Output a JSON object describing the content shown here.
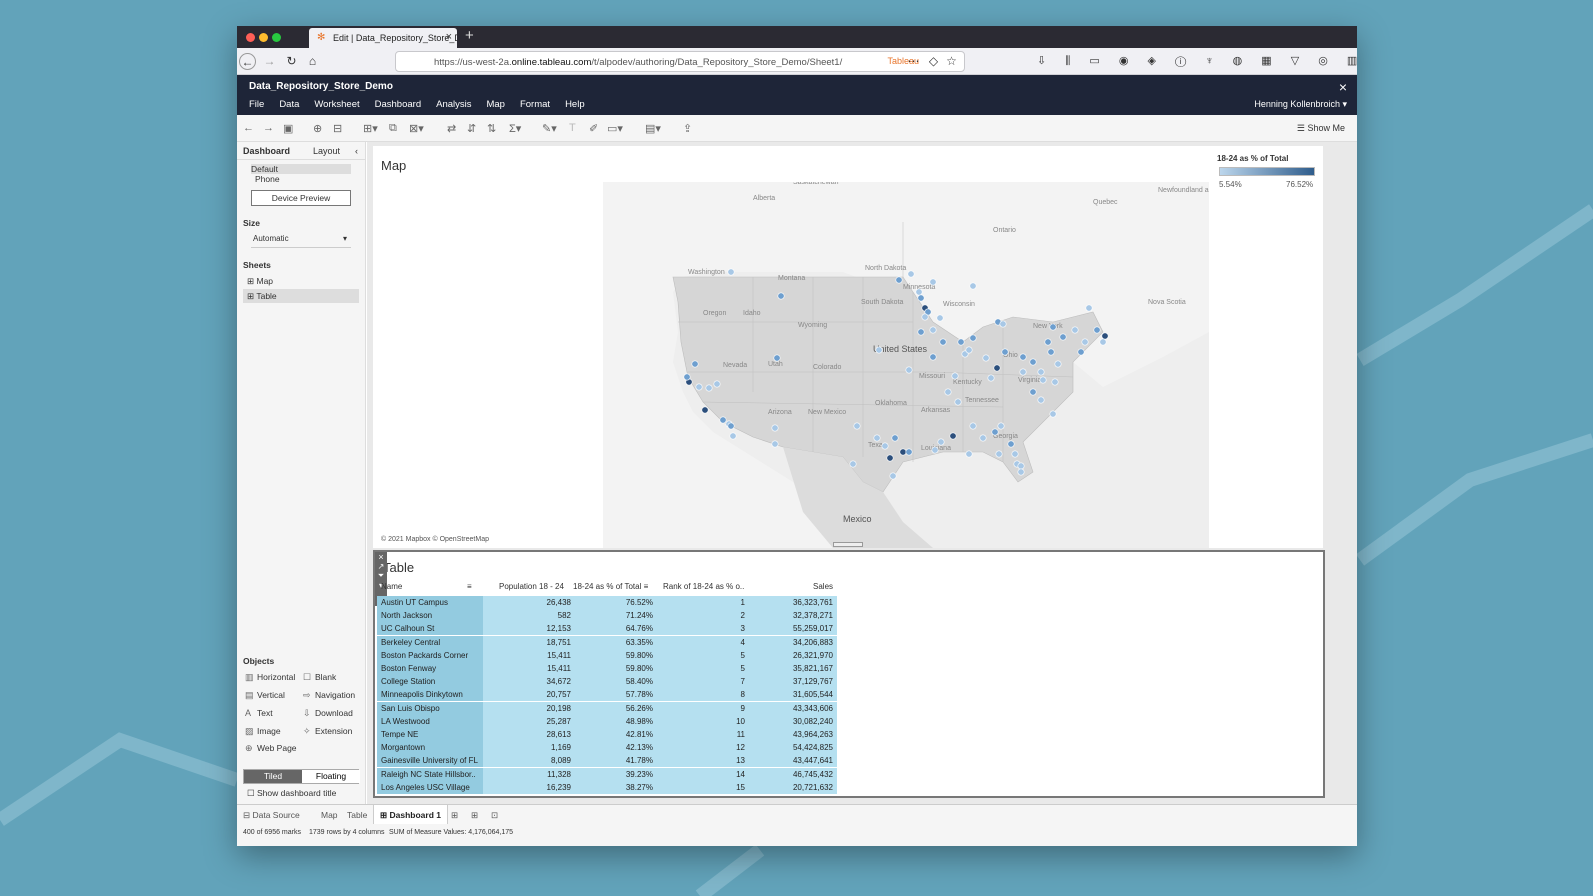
{
  "browser": {
    "tab_title": "Edit | Data_Repository_Store_De",
    "url_prefix": "https://us-west-2a.",
    "url_host": "online.tableau.com",
    "url_path": "/t/alpodev/authoring/Data_Repository_Store_Demo/Sheet1/",
    "url_badge": "Tableau"
  },
  "app": {
    "workbook_title": "Data_Repository_Store_Demo",
    "menu": [
      "File",
      "Data",
      "Worksheet",
      "Dashboard",
      "Analysis",
      "Map",
      "Format",
      "Help"
    ],
    "user": "Henning Kollenbroich",
    "show_me": "Show Me"
  },
  "left_panel": {
    "tabs": [
      "Dashboard",
      "Layout"
    ],
    "device_default": "Default",
    "device_phone": "Phone",
    "device_preview": "Device Preview",
    "size_label": "Size",
    "size_value": "Automatic",
    "sheets_label": "Sheets",
    "sheets": [
      "Map",
      "Table"
    ],
    "objects_label": "Objects",
    "objects": [
      "Horizontal",
      "Blank",
      "Vertical",
      "Navigation",
      "Text",
      "Download",
      "Image",
      "Extension",
      "Web Page"
    ],
    "tiled": "Tiled",
    "floating": "Floating",
    "show_title": "Show dashboard title"
  },
  "map": {
    "title": "Map",
    "legend_title": "18-24 as % of Total",
    "legend_min": "5.54%",
    "legend_max": "76.52%",
    "attribution": "© 2021 Mapbox  © OpenStreetMap",
    "labels": [
      "Alberta",
      "Saskatchewan",
      "Ontario",
      "Quebec",
      "Newfoundland and Labrador",
      "Washington",
      "Montana",
      "North Dakota",
      "Minnesota",
      "Wisconsin",
      "Oregon",
      "Idaho",
      "Wyoming",
      "South Dakota",
      "Nevada",
      "Utah",
      "Colorado",
      "United States",
      "Missouri",
      "Kentucky",
      "Ohio",
      "Virginia",
      "New York",
      "Nova Scotia",
      "Arizona",
      "New Mexico",
      "Oklahoma",
      "Arkansas",
      "Tennessee",
      "Texas",
      "Louisiana",
      "Georgia",
      "Mexico"
    ],
    "colors": {
      "light": "#a8c8e6",
      "mid": "#6e9fcf",
      "dark": "#2c4f7c"
    }
  },
  "table": {
    "title": "Table",
    "columns": [
      "Name",
      "Population 18 - 24",
      "18-24 as % of Total",
      "Rank of 18-24 as % o..",
      "Sales"
    ],
    "rows": [
      [
        "Austin UT Campus",
        "26,438",
        "76.52%",
        "1",
        "36,323,761"
      ],
      [
        "North Jackson",
        "582",
        "71.24%",
        "2",
        "32,378,271"
      ],
      [
        "UC Calhoun St",
        "12,153",
        "64.76%",
        "3",
        "55,259,017"
      ],
      [
        "Berkeley Central",
        "18,751",
        "63.35%",
        "4",
        "34,206,883"
      ],
      [
        "Boston Packards Corner",
        "15,411",
        "59.80%",
        "5",
        "26,321,970"
      ],
      [
        "Boston Fenway",
        "15,411",
        "59.80%",
        "5",
        "35,821,167"
      ],
      [
        "College Station",
        "34,672",
        "58.40%",
        "7",
        "37,129,767"
      ],
      [
        "Minneapolis Dinkytown",
        "20,757",
        "57.78%",
        "8",
        "31,605,544"
      ],
      [
        "San Luis Obispo",
        "20,198",
        "56.26%",
        "9",
        "43,343,606"
      ],
      [
        "LA Westwood",
        "25,287",
        "48.98%",
        "10",
        "30,082,240"
      ],
      [
        "Tempe NE",
        "28,613",
        "42.81%",
        "11",
        "43,964,263"
      ],
      [
        "Morgantown",
        "1,169",
        "42.13%",
        "12",
        "54,424,825"
      ],
      [
        "Gainesville University of FL",
        "8,089",
        "41.78%",
        "13",
        "43,447,641"
      ],
      [
        "Raleigh NC State Hillsbor..",
        "11,328",
        "39.23%",
        "14",
        "46,745,432"
      ],
      [
        "Los Angeles USC Village",
        "16,239",
        "38.27%",
        "15",
        "20,721,632"
      ]
    ]
  },
  "bottom": {
    "data_source": "Data Source",
    "tabs": [
      "Map",
      "Table",
      "Dashboard 1"
    ],
    "status": [
      "400 of 6956 marks",
      "1739 rows by 4 columns",
      "SUM of Measure Values: 4,176,064,175"
    ]
  }
}
